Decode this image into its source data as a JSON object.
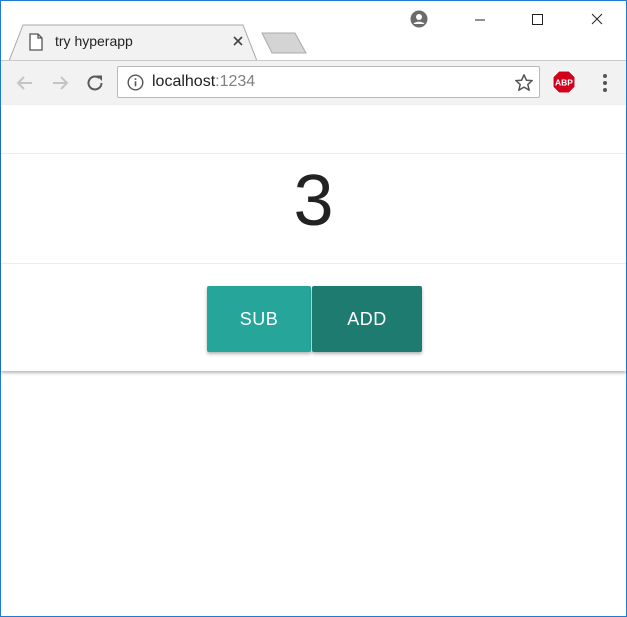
{
  "browser": {
    "tab": {
      "title": "try hyperapp"
    },
    "address_bar": {
      "host": "localhost",
      "port": ":1234"
    },
    "extension": {
      "label": "ABP"
    },
    "icons": {
      "tab": "page-icon",
      "close": "close-icon",
      "account": "account-icon",
      "back": "back-arrow-icon",
      "forward": "forward-arrow-icon",
      "reload": "reload-icon",
      "info": "info-icon",
      "bookmark": "star-icon",
      "menu": "kebab-menu-icon"
    },
    "colors": {
      "window_border": "#1e7ad6",
      "toolbar": "#f2f2f2",
      "abp_red": "#d0021b"
    }
  },
  "app": {
    "counter": "3",
    "sub_label": "SUB",
    "add_label": "ADD",
    "colors": {
      "sub_button": "#26a69a",
      "add_button": "#1e7b70"
    }
  }
}
